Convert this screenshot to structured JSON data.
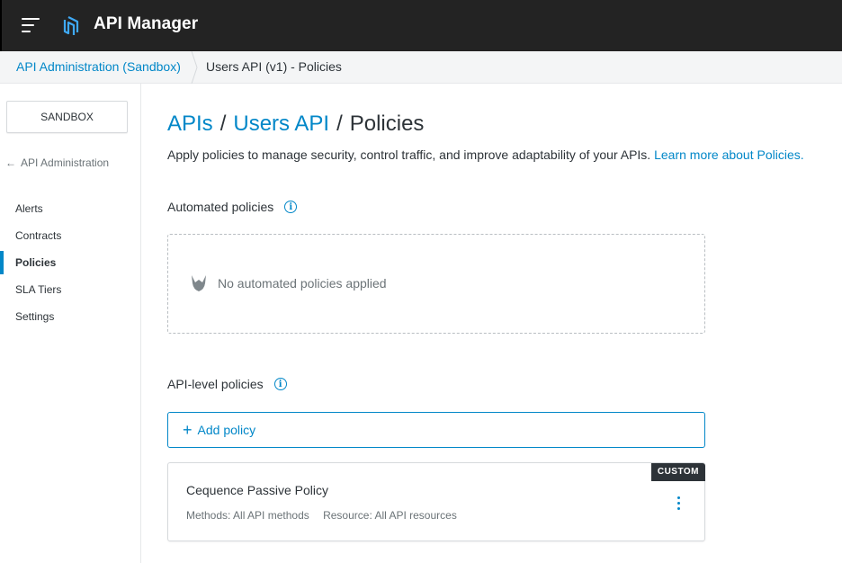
{
  "app": {
    "title": "API Manager"
  },
  "breadcrumb": {
    "parent": "API Administration (Sandbox)",
    "current": "Users API (v1) - Policies"
  },
  "sidebar": {
    "environment": "SANDBOX",
    "back_label": "API Administration",
    "items": [
      {
        "label": "Alerts",
        "active": false
      },
      {
        "label": "Contracts",
        "active": false
      },
      {
        "label": "Policies",
        "active": true
      },
      {
        "label": "SLA Tiers",
        "active": false
      },
      {
        "label": "Settings",
        "active": false
      }
    ]
  },
  "main": {
    "heading": {
      "apis": "APIs",
      "api_name": "Users API",
      "current": "Policies",
      "separator": "/"
    },
    "description": "Apply policies to manage security, control traffic, and improve adaptability of your APIs.",
    "learn_more": "Learn more about Policies.",
    "automated": {
      "title": "Automated policies",
      "empty_text": "No automated policies applied"
    },
    "api_level": {
      "title": "API-level policies",
      "add_label": "Add policy",
      "policies": [
        {
          "badge": "CUSTOM",
          "name": "Cequence Passive Policy",
          "methods": "Methods: All API methods",
          "resource": "Resource: All API resources"
        }
      ]
    }
  },
  "colors": {
    "accent": "#0287c8",
    "topbar": "#232323",
    "text": "#2d3338"
  }
}
